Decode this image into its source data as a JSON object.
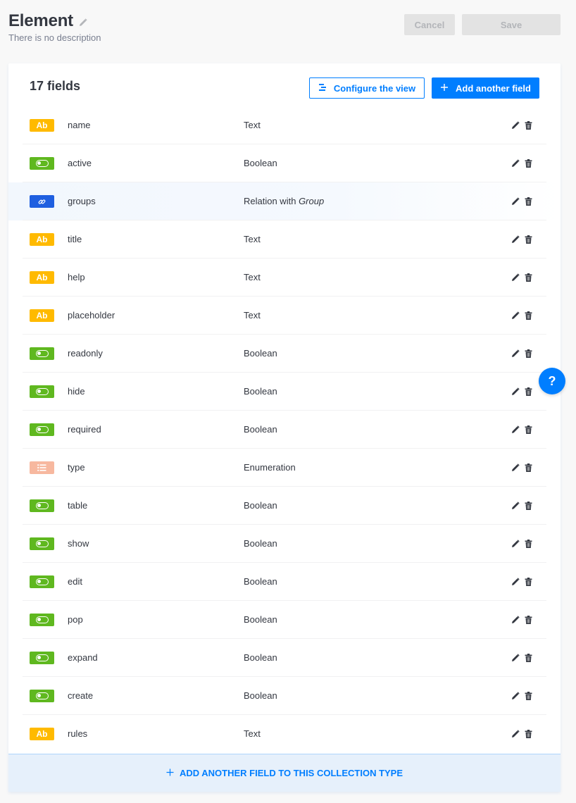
{
  "header": {
    "title": "Element",
    "description": "There is no description",
    "cancel_label": "Cancel",
    "save_label": "Save"
  },
  "card": {
    "field_count": "17 fields",
    "configure_label": "Configure the view",
    "add_field_label": "Add another field",
    "footer_add_label": "ADD ANOTHER FIELD TO THIS COLLECTION TYPE"
  },
  "badge_icons": {
    "text": "Ab",
    "boolean": "toggle-icon",
    "relation": "link-icon",
    "enumeration": "list-icon"
  },
  "colors": {
    "primary": "#007eff",
    "text_badge": "#ffba00",
    "boolean_badge": "#5fb81f",
    "relation_badge": "#1f5fe0",
    "enumeration_badge": "#f7b89f"
  },
  "fields": [
    {
      "name": "name",
      "type": "Text",
      "kind": "text"
    },
    {
      "name": "active",
      "type": "Boolean",
      "kind": "boolean"
    },
    {
      "name": "groups",
      "type": "Relation with",
      "target": "Group",
      "kind": "relation"
    },
    {
      "name": "title",
      "type": "Text",
      "kind": "text"
    },
    {
      "name": "help",
      "type": "Text",
      "kind": "text"
    },
    {
      "name": "placeholder",
      "type": "Text",
      "kind": "text"
    },
    {
      "name": "readonly",
      "type": "Boolean",
      "kind": "boolean"
    },
    {
      "name": "hide",
      "type": "Boolean",
      "kind": "boolean"
    },
    {
      "name": "required",
      "type": "Boolean",
      "kind": "boolean"
    },
    {
      "name": "type",
      "type": "Enumeration",
      "kind": "enumeration"
    },
    {
      "name": "table",
      "type": "Boolean",
      "kind": "boolean"
    },
    {
      "name": "show",
      "type": "Boolean",
      "kind": "boolean"
    },
    {
      "name": "edit",
      "type": "Boolean",
      "kind": "boolean"
    },
    {
      "name": "pop",
      "type": "Boolean",
      "kind": "boolean"
    },
    {
      "name": "expand",
      "type": "Boolean",
      "kind": "boolean"
    },
    {
      "name": "create",
      "type": "Boolean",
      "kind": "boolean"
    },
    {
      "name": "rules",
      "type": "Text",
      "kind": "text"
    }
  ],
  "help_button": "?"
}
